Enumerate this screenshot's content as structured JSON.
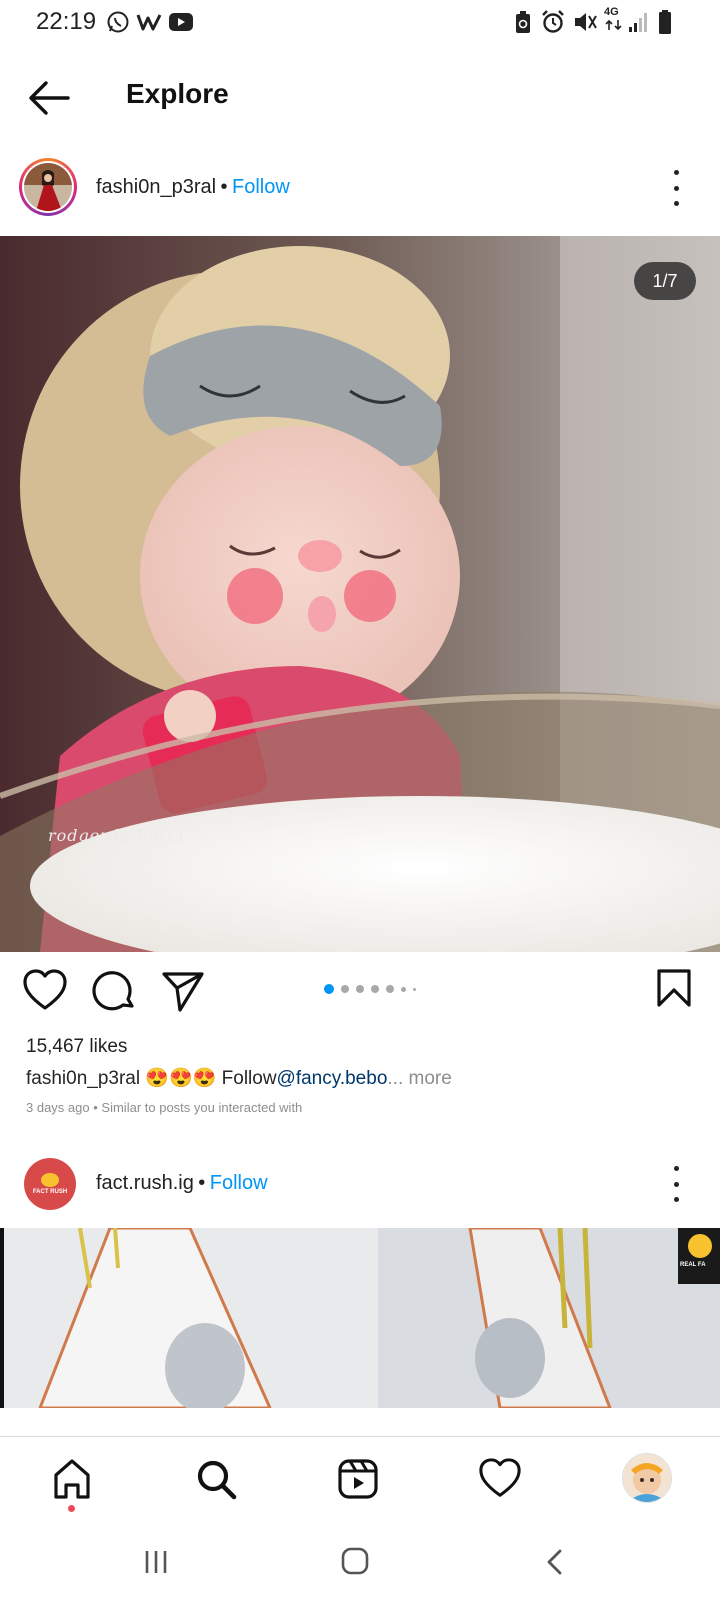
{
  "status_bar": {
    "time": "22:19",
    "left_icons": [
      "whatsapp-icon",
      "w-app-icon",
      "youtube-icon"
    ],
    "right_icons": [
      "recycle-icon",
      "alarm-icon",
      "mute-icon",
      "network-4g-icon",
      "signal-icon",
      "battery-icon"
    ],
    "network_label": "4G"
  },
  "header": {
    "title": "Explore"
  },
  "post1": {
    "username": "fashi0n_p3ral",
    "separator": "•",
    "follow_label": "Follow",
    "image_counter": "1/7",
    "watermark": "rodgerdollob11",
    "likes": "15,467 likes",
    "caption_user": "fashi0n_p3ral",
    "caption_emojis": "😍😍😍",
    "caption_text": "Follow",
    "caption_mention": "@fancy.bebo",
    "caption_more": "... more",
    "timestamp": "3 days ago",
    "meta_separator": "•",
    "reason": "Similar to posts you interacted with",
    "carousel_total": 7,
    "carousel_active": 1
  },
  "post2": {
    "username": "fact.rush.ig",
    "separator": "•",
    "follow_label": "Follow",
    "avatar_text": "FACT RUSH",
    "badge_text": "REAL FA"
  },
  "bottom_nav": [
    {
      "name": "home",
      "icon": "home-icon",
      "active": true
    },
    {
      "name": "search",
      "icon": "search-icon",
      "active": false
    },
    {
      "name": "reels",
      "icon": "reels-icon",
      "active": false
    },
    {
      "name": "activity",
      "icon": "heart-icon",
      "active": false
    },
    {
      "name": "profile",
      "icon": "profile-avatar-icon",
      "active": false
    }
  ],
  "colors": {
    "accent": "#0095f6",
    "notification_dot": "#ed4956",
    "text": "#262626",
    "muted": "#8e8e8e"
  }
}
